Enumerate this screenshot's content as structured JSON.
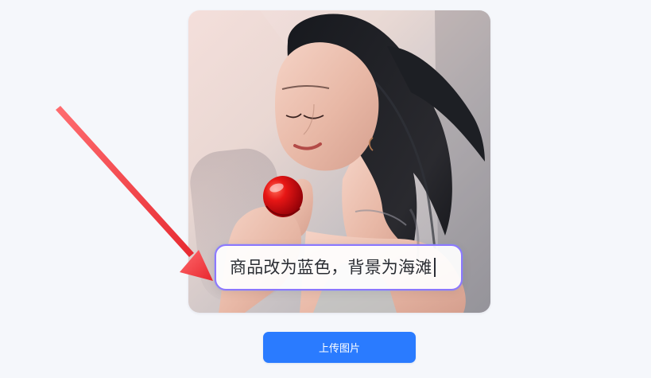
{
  "editor": {
    "prompt_text": "商品改为蓝色，背景为海滩"
  },
  "actions": {
    "upload_label": "上传图片"
  },
  "image": {
    "accent_color": "#8c77ff",
    "product_color": "#d90f12"
  },
  "overlay": {
    "arrow_color": "#f0383d"
  },
  "icons": {
    "arrow": "arrow-pointer-icon"
  }
}
